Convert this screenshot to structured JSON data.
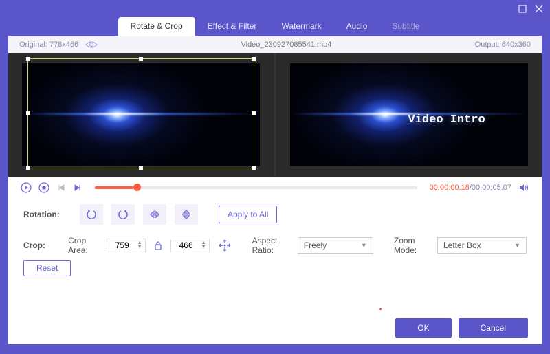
{
  "window": {
    "maximize_icon": "maximize",
    "close_icon": "close"
  },
  "tabs": {
    "rotate_crop": "Rotate & Crop",
    "effect_filter": "Effect & Filter",
    "watermark": "Watermark",
    "audio": "Audio",
    "subtitle": "Subtitle"
  },
  "preview": {
    "original_label": "Original:",
    "original_dims": "778x466",
    "filename": "Video_230927085541.mp4",
    "output_label": "Output:",
    "output_dims": "640x360",
    "intro_text": "Video Intro"
  },
  "playback": {
    "current_time": "00:00:00.18",
    "total_time": "00:00:05.07",
    "sep": "/"
  },
  "rotation": {
    "label": "Rotation:",
    "apply_all": "Apply to All"
  },
  "crop": {
    "label": "Crop:",
    "crop_area_label": "Crop Area:",
    "width": "759",
    "height": "466",
    "aspect_label": "Aspect Ratio:",
    "aspect_value": "Freely",
    "zoom_label": "Zoom Mode:",
    "zoom_value": "Letter Box",
    "reset": "Reset"
  },
  "footer": {
    "ok": "OK",
    "cancel": "Cancel"
  }
}
